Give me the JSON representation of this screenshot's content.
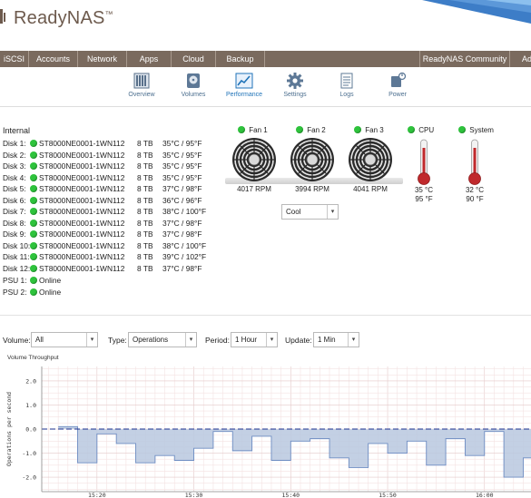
{
  "brand": {
    "name": "ReadyNAS",
    "trademark": "™"
  },
  "topnav": {
    "items": [
      {
        "label": "iSCSI"
      },
      {
        "label": "Accounts"
      },
      {
        "label": "Network"
      },
      {
        "label": "Apps"
      },
      {
        "label": "Cloud"
      },
      {
        "label": "Backup"
      }
    ],
    "community": "ReadyNAS Community",
    "partial": "Ad"
  },
  "subnav": {
    "items": [
      {
        "label": "Overview",
        "icon": "overview-icon"
      },
      {
        "label": "Volumes",
        "icon": "volumes-icon"
      },
      {
        "label": "Performance",
        "icon": "performance-icon",
        "active": true
      },
      {
        "label": "Settings",
        "icon": "settings-gear-icon"
      },
      {
        "label": "Logs",
        "icon": "logs-icon"
      },
      {
        "label": "Power",
        "icon": "power-icon"
      }
    ]
  },
  "internal": {
    "title": "Internal",
    "disks": [
      {
        "label": "Disk 1:",
        "model": "ST8000NE0001-1WN112",
        "size": "8 TB",
        "temp": "35°C / 95°F"
      },
      {
        "label": "Disk 2:",
        "model": "ST8000NE0001-1WN112",
        "size": "8 TB",
        "temp": "35°C / 95°F"
      },
      {
        "label": "Disk 3:",
        "model": "ST8000NE0001-1WN112",
        "size": "8 TB",
        "temp": "35°C / 95°F"
      },
      {
        "label": "Disk 4:",
        "model": "ST8000NE0001-1WN112",
        "size": "8 TB",
        "temp": "35°C / 95°F"
      },
      {
        "label": "Disk 5:",
        "model": "ST8000NE0001-1WN112",
        "size": "8 TB",
        "temp": "37°C / 98°F"
      },
      {
        "label": "Disk 6:",
        "model": "ST8000NE0001-1WN112",
        "size": "8 TB",
        "temp": "36°C / 96°F"
      },
      {
        "label": "Disk 7:",
        "model": "ST8000NE0001-1WN112",
        "size": "8 TB",
        "temp": "38°C / 100°F"
      },
      {
        "label": "Disk 8:",
        "model": "ST8000NE0001-1WN112",
        "size": "8 TB",
        "temp": "37°C / 98°F"
      },
      {
        "label": "Disk 9:",
        "model": "ST8000NE0001-1WN112",
        "size": "8 TB",
        "temp": "37°C / 98°F"
      },
      {
        "label": "Disk 10:",
        "model": "ST8000NE0001-1WN112",
        "size": "8 TB",
        "temp": "38°C / 100°F"
      },
      {
        "label": "Disk 11:",
        "model": "ST8000NE0001-1WN112",
        "size": "8 TB",
        "temp": "39°C / 102°F"
      },
      {
        "label": "Disk 12:",
        "model": "ST8000NE0001-1WN112",
        "size": "8 TB",
        "temp": "37°C / 98°F"
      }
    ],
    "psus": [
      {
        "label": "PSU 1:",
        "status": "Online"
      },
      {
        "label": "PSU 2:",
        "status": "Online"
      }
    ],
    "status_color": "#2ec33c"
  },
  "fans": [
    {
      "name": "Fan 1",
      "rpm": "4017 RPM"
    },
    {
      "name": "Fan 2",
      "rpm": "3994 RPM"
    },
    {
      "name": "Fan 3",
      "rpm": "4041 RPM"
    }
  ],
  "fan_mode": {
    "value": "Cool"
  },
  "temps": [
    {
      "name": "CPU",
      "c": "35 °C",
      "f": "95 °F"
    },
    {
      "name": "System",
      "c": "32 °C",
      "f": "90 °F"
    }
  ],
  "filters": {
    "volume": {
      "label": "Volume:",
      "value": "All"
    },
    "type": {
      "label": "Type:",
      "value": "Operations"
    },
    "period": {
      "label": "Period:",
      "value": "1 Hour"
    },
    "update": {
      "label": "Update:",
      "value": "1 Min"
    }
  },
  "chart_title": "Volume Throughput",
  "chart_data": {
    "type": "area",
    "title": "Volume Throughput",
    "xlabel": "",
    "ylabel": "Operations per second",
    "ylim": [
      -2.6,
      2.6
    ],
    "yticks": [
      "2.0",
      "1.0",
      "0.0",
      "-1.0",
      "-2.0"
    ],
    "ytick_values": [
      2.0,
      1.0,
      0.0,
      -1.0,
      -2.0
    ],
    "xticks": [
      "15:20",
      "15:30",
      "15:40",
      "15:50",
      "16:00"
    ],
    "xtick_values": [
      20,
      30,
      40,
      50,
      60
    ],
    "xlim": [
      14.3,
      64.8
    ],
    "grid": true,
    "fill_color": "#b9c8df",
    "line_color": "#6d8cc2",
    "x": [
      16,
      18,
      20,
      22,
      24,
      26,
      28,
      30,
      32,
      34,
      36,
      38,
      40,
      42,
      44,
      46,
      48,
      50,
      52,
      54,
      56,
      58,
      60,
      62,
      64
    ],
    "values": [
      0.1,
      -1.4,
      -0.2,
      -0.6,
      -1.4,
      -1.1,
      -1.3,
      -0.8,
      -0.1,
      -0.9,
      -0.3,
      -1.3,
      -0.5,
      -0.4,
      -1.2,
      -1.6,
      -0.6,
      -1.0,
      -0.5,
      -1.5,
      -0.4,
      -1.1,
      -0.1,
      -2.0,
      -1.2
    ]
  }
}
